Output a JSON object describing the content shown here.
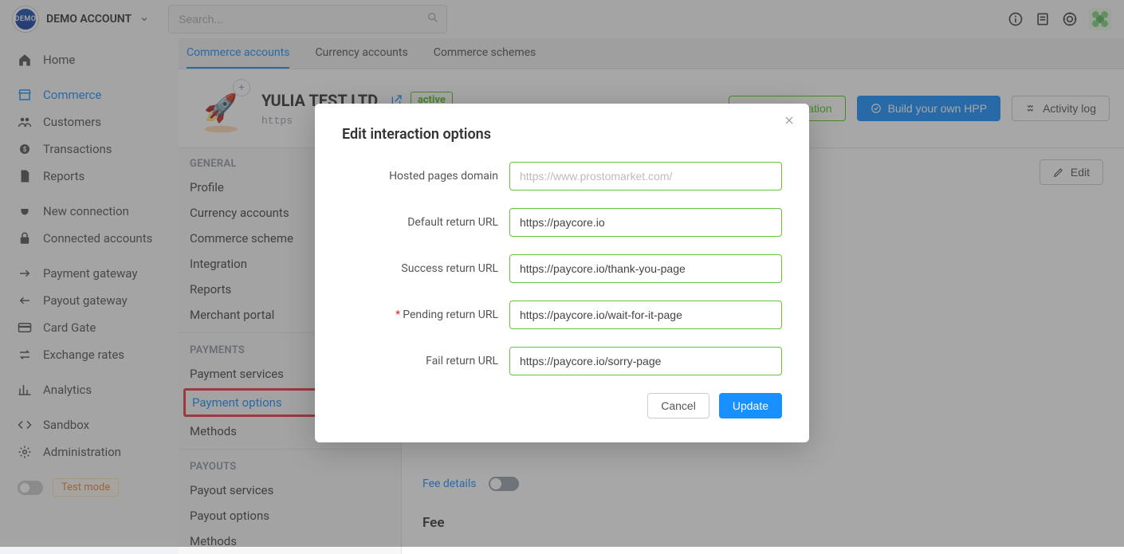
{
  "org_name": "DEMO ACCOUNT",
  "logo_text": "DEMO",
  "search": {
    "placeholder": "Search..."
  },
  "nav": [
    {
      "label": "Home",
      "icon": "home"
    },
    {
      "label": "Commerce",
      "icon": "shop",
      "active": true
    },
    {
      "label": "Customers",
      "icon": "users"
    },
    {
      "label": "Transactions",
      "icon": "coin"
    },
    {
      "label": "Reports",
      "icon": "file"
    }
  ],
  "nav2": [
    {
      "label": "New connection",
      "icon": "plug"
    },
    {
      "label": "Connected accounts",
      "icon": "lock"
    }
  ],
  "nav3": [
    {
      "label": "Payment gateway",
      "icon": "arrow-right"
    },
    {
      "label": "Payout gateway",
      "icon": "arrow-left"
    },
    {
      "label": "Card Gate",
      "icon": "card"
    },
    {
      "label": "Exchange rates",
      "icon": "exchange"
    }
  ],
  "nav4": [
    {
      "label": "Analytics",
      "icon": "chart"
    }
  ],
  "nav5": [
    {
      "label": "Sandbox",
      "icon": "code"
    },
    {
      "label": "Administration",
      "icon": "gear"
    }
  ],
  "test_mode_label": "Test mode",
  "tabs": [
    {
      "label": "Commerce accounts",
      "active": true
    },
    {
      "label": "Currency accounts"
    },
    {
      "label": "Commerce schemes"
    }
  ],
  "company": {
    "name": "YULIA TEST LTD.",
    "status": "active",
    "url": "https"
  },
  "actions": {
    "new_op": "New operation",
    "build_hpp": "Build your own HPP",
    "activity_log": "Activity log",
    "edit": "Edit"
  },
  "subnav_general_title": "GENERAL",
  "subnav_general": [
    "Profile",
    "Currency accounts",
    "Commerce scheme",
    "Integration",
    "Reports",
    "Merchant portal"
  ],
  "subnav_payments_title": "PAYMENTS",
  "subnav_payments": [
    "Payment services",
    "Payment options",
    "Methods"
  ],
  "subnav_payouts_title": "PAYOUTS",
  "subnav_payouts": [
    "Payout services",
    "Payout options",
    "Methods"
  ],
  "fee_details_label": "Fee details",
  "fee_heading": "Fee",
  "modal": {
    "title": "Edit interaction options",
    "hosted_domain": {
      "label": "Hosted pages domain",
      "value": "",
      "placeholder": "https://www.prostomarket.com/"
    },
    "default_return": {
      "label": "Default return URL",
      "value": "https://paycore.io"
    },
    "success_return": {
      "label": "Success return URL",
      "value": "https://paycore.io/thank-you-page"
    },
    "pending_return": {
      "label": "Pending return URL",
      "value": "https://paycore.io/wait-for-it-page",
      "required": true
    },
    "fail_return": {
      "label": "Fail return URL",
      "value": "https://paycore.io/sorry-page"
    },
    "cancel": "Cancel",
    "update": "Update",
    "required_mark": "*"
  }
}
